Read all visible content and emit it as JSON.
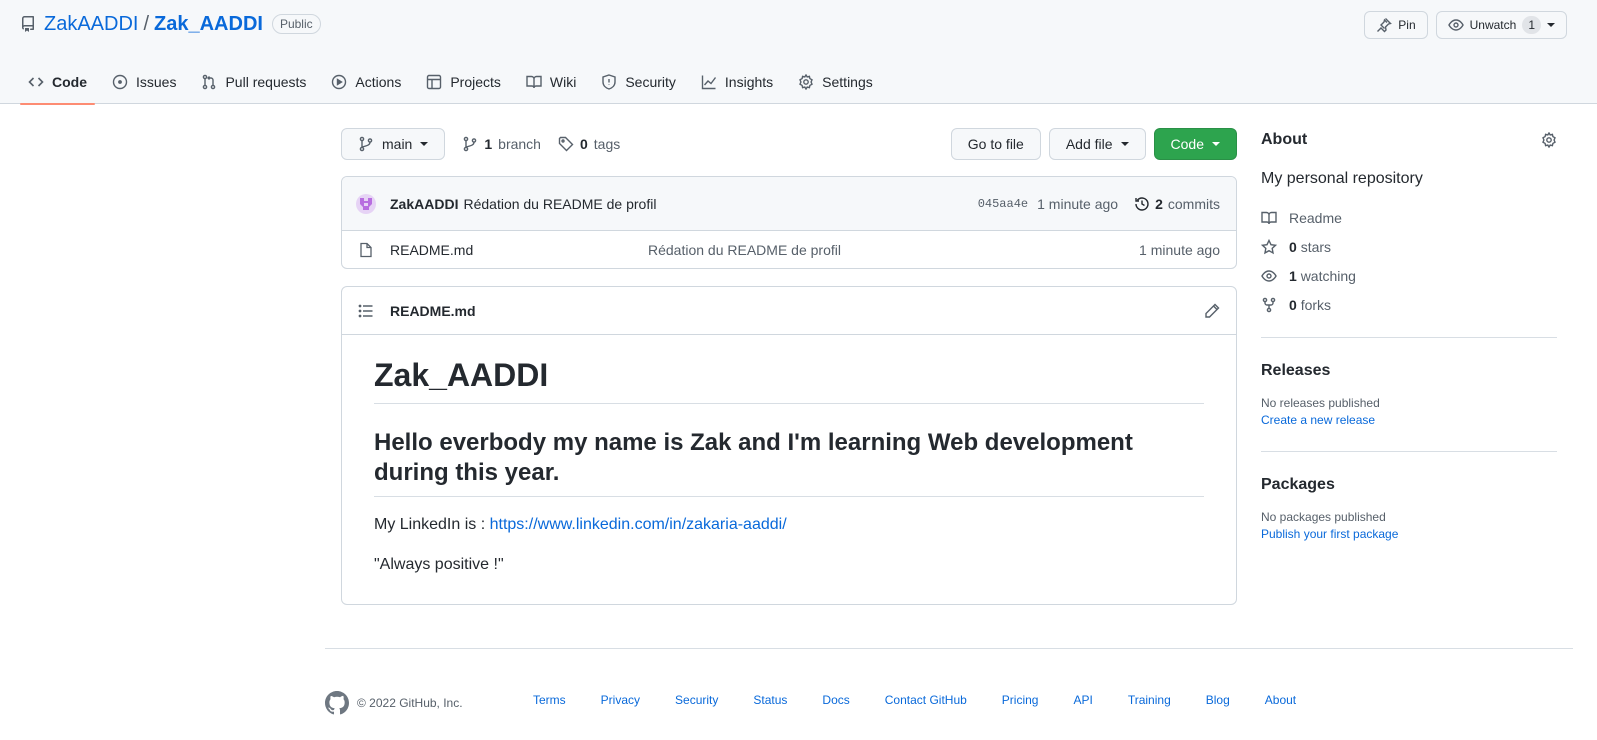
{
  "repo": {
    "owner": "ZakAADDI",
    "separator": "/",
    "name": "Zak_AADDI",
    "visibility": "Public"
  },
  "header_actions": {
    "pin_label": "Pin",
    "unwatch_label": "Unwatch",
    "watch_count": "1"
  },
  "nav": {
    "tabs": [
      {
        "label": "Code",
        "icon": "code-icon"
      },
      {
        "label": "Issues",
        "icon": "issue-icon"
      },
      {
        "label": "Pull requests",
        "icon": "pull-request-icon"
      },
      {
        "label": "Actions",
        "icon": "play-icon"
      },
      {
        "label": "Projects",
        "icon": "table-icon"
      },
      {
        "label": "Wiki",
        "icon": "book-icon"
      },
      {
        "label": "Security",
        "icon": "shield-icon"
      },
      {
        "label": "Insights",
        "icon": "graph-icon"
      },
      {
        "label": "Settings",
        "icon": "gear-icon"
      }
    ],
    "active": "Code"
  },
  "toolbar": {
    "branch": "main",
    "branch_count": "1",
    "branch_word": "branch",
    "tag_count": "0",
    "tag_word": "tags",
    "go_to_file": "Go to file",
    "add_file": "Add file",
    "code": "Code"
  },
  "commit": {
    "author": "ZakAADDI",
    "message": "Rédation du README de profil",
    "sha": "045aa4e",
    "age": "1 minute ago",
    "commit_count": "2",
    "commit_word": "commits"
  },
  "files": [
    {
      "name": "README.md",
      "message": "Rédation du README de profil",
      "age": "1 minute ago"
    }
  ],
  "readme": {
    "file_label": "README.md",
    "h1": "Zak_AADDI",
    "h2": "Hello everbody my name is Zak and I'm learning Web development during this year.",
    "linkedin_prefix": "My LinkedIn is : ",
    "linkedin_url": "https://www.linkedin.com/in/zakaria-aaddi/",
    "quote": "\"Always positive !\""
  },
  "about": {
    "title": "About",
    "description": "My personal repository",
    "readme_label": "Readme",
    "stars_count": "0",
    "stars_word": "stars",
    "watching_count": "1",
    "watching_word": "watching",
    "forks_count": "0",
    "forks_word": "forks"
  },
  "releases": {
    "title": "Releases",
    "empty_text": "No releases published",
    "create_link": "Create a new release"
  },
  "packages": {
    "title": "Packages",
    "empty_text": "No packages published",
    "publish_link": "Publish your first package"
  },
  "footer": {
    "copyright": "© 2022 GitHub, Inc.",
    "links": [
      "Terms",
      "Privacy",
      "Security",
      "Status",
      "Docs",
      "Contact GitHub",
      "Pricing",
      "API",
      "Training",
      "Blog",
      "About"
    ]
  },
  "colors": {
    "accent_link": "#0969da",
    "primary_button": "#2da44e",
    "active_tab_underline": "#fd8c73",
    "muted_text": "#57606a",
    "border": "#d0d7de"
  }
}
